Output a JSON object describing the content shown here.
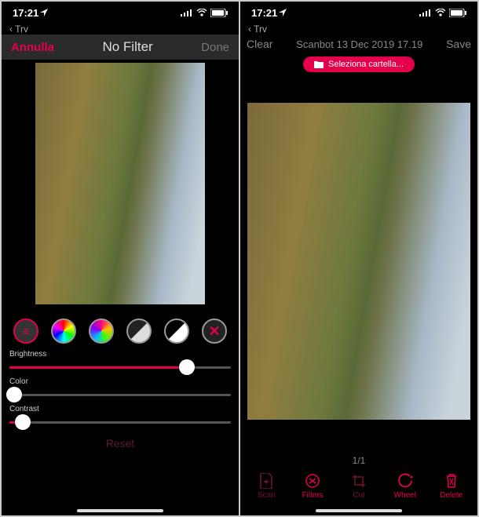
{
  "status": {
    "time": "17:21",
    "location_arrow": "↗"
  },
  "back_nav": "‹ Trv",
  "left": {
    "header": {
      "cancel": "Annulla",
      "title": "No Filter",
      "done": "Done"
    },
    "filters": {
      "none": "≡",
      "x": "✕"
    },
    "sliders": {
      "brightness": {
        "label": "Brightness",
        "value": 80
      },
      "color": {
        "label": "Color",
        "value": 2
      },
      "contrast": {
        "label": "Contrast",
        "value": 6
      }
    },
    "reset": "Reset"
  },
  "right": {
    "header": {
      "clear": "Clear",
      "filename": "Scanbot 13 Dec 2019 17.19",
      "save": "Save"
    },
    "folder_button": "Seleziona cartella...",
    "page_indicator": "1/1",
    "toolbar": {
      "scan": "Scan",
      "filters": "Filters",
      "cut": "Cut",
      "wheel": "Wheel",
      "delete": "Delete"
    }
  }
}
